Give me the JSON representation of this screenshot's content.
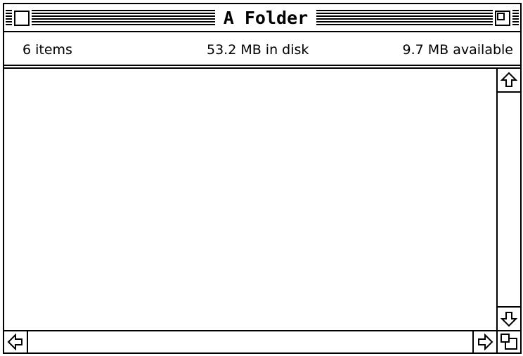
{
  "window": {
    "title": "A Folder"
  },
  "info": {
    "items": "6 items",
    "disk": "53.2 MB in disk",
    "available": "9.7 MB available"
  },
  "icons": [
    "close-box-icon",
    "zoom-box-icon",
    "arrow-up-icon",
    "arrow-down-icon",
    "arrow-left-icon",
    "arrow-right-icon",
    "grow-box-icon"
  ],
  "colors": {
    "foreground": "#000000",
    "background": "#ffffff"
  }
}
